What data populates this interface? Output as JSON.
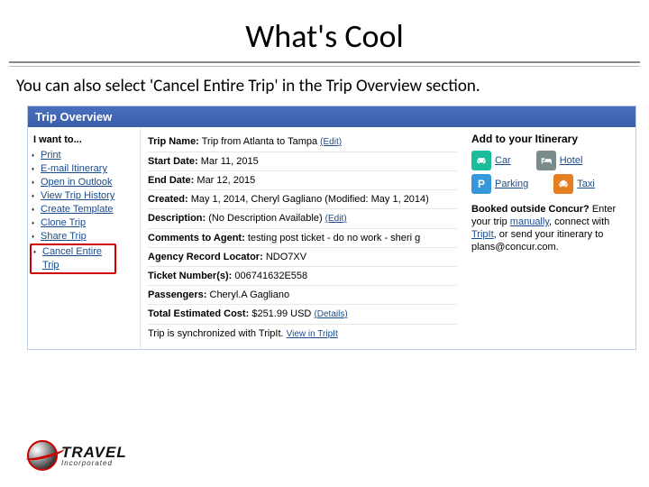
{
  "slide": {
    "title": "What's Cool",
    "subtitle": "You can also select 'Cancel Entire Trip' in the Trip Overview section."
  },
  "panel": {
    "header": "Trip Overview",
    "iwant_title": "I want to...",
    "iwant_items": [
      {
        "label": "Print",
        "highlight": false
      },
      {
        "label": "E-mail Itinerary",
        "highlight": false
      },
      {
        "label": "Open in Outlook",
        "highlight": false
      },
      {
        "label": "View Trip History",
        "highlight": false
      },
      {
        "label": "Create Template",
        "highlight": false
      },
      {
        "label": "Clone Trip",
        "highlight": false
      },
      {
        "label": "Share Trip",
        "highlight": false
      },
      {
        "label": "Cancel Entire Trip",
        "highlight": true
      }
    ],
    "details": {
      "trip_name_label": "Trip Name:",
      "trip_name_value": "Trip from Atlanta to Tampa",
      "edit_label": "(Edit)",
      "start_label": "Start Date:",
      "start_value": "Mar 11, 2015",
      "end_label": "End Date:",
      "end_value": "Mar 12, 2015",
      "created_label": "Created:",
      "created_value": "May 1, 2014, Cheryl Gagliano (Modified: May 1, 2014)",
      "desc_label": "Description:",
      "desc_value": "(No Description Available)",
      "comments_label": "Comments to Agent:",
      "comments_value": "testing post ticket - do no work - sheri g",
      "arl_label": "Agency Record Locator:",
      "arl_value": "NDO7XV",
      "ticket_label": "Ticket Number(s):",
      "ticket_value": "006741632E558",
      "pax_label": "Passengers:",
      "pax_value": "Cheryl.A Gagliano",
      "cost_label": "Total Estimated Cost:",
      "cost_value": "$251.99 USD",
      "details_link": "(Details)",
      "tripit_text": "Trip is synchronized with TripIt.",
      "tripit_link": "View in TripIt"
    },
    "add": {
      "title": "Add to your Itinerary",
      "items": {
        "car": "Car",
        "hotel": "Hotel",
        "parking": "Parking",
        "taxi": "Taxi"
      },
      "booked_title": "Booked outside Concur?",
      "booked_rest_1": " Enter your trip ",
      "booked_link_1": "manually",
      "booked_rest_2": ", connect with ",
      "booked_link_2": "TripIt",
      "booked_rest_3": ", or send your itinerary to plans@concur.com."
    }
  },
  "footer": {
    "logo_top": "TRAVEL",
    "logo_bottom": "Incorporated"
  }
}
